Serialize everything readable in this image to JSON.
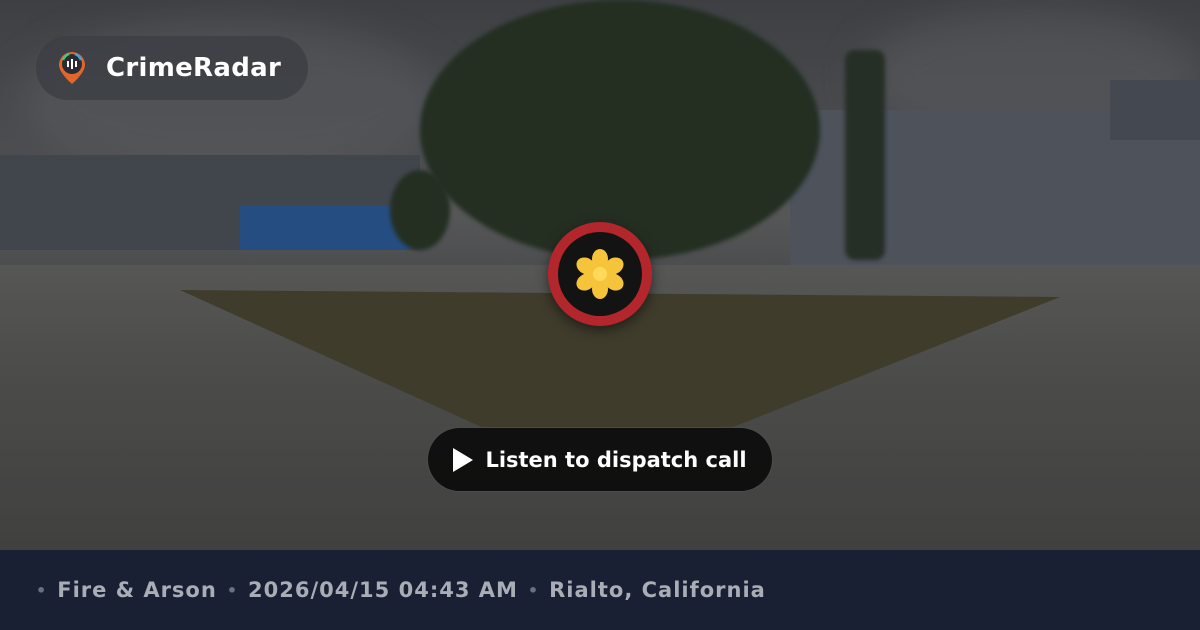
{
  "brand": {
    "name": "CrimeRadar",
    "logo_icon": "radar-pin-icon"
  },
  "incident": {
    "category_icon": "fire-asterisk-icon",
    "marker_ring_color": "#b3262b"
  },
  "player": {
    "label": "Listen to dispatch call",
    "icon": "play-icon"
  },
  "footer": {
    "category": "Fire & Arson",
    "datetime": "2026/04/15 04:43 AM",
    "location": "Rialto, California",
    "separator": "•"
  }
}
